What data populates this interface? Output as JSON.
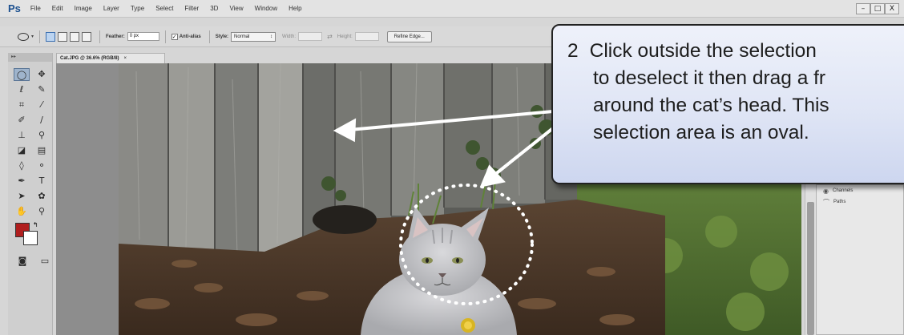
{
  "app": {
    "logo": "Ps",
    "menu": [
      "File",
      "Edit",
      "Image",
      "Layer",
      "Type",
      "Select",
      "Filter",
      "3D",
      "View",
      "Window",
      "Help"
    ],
    "window_controls": [
      "–",
      "□",
      "X"
    ]
  },
  "options_bar": {
    "feather_label": "Feather:",
    "feather_value": "0 px",
    "antialias_label": "Anti-alias",
    "antialias_checked": true,
    "style_label": "Style:",
    "style_value": "Normal",
    "width_label": "Width:",
    "height_label": "Height:",
    "refine_edge_label": "Refine Edge..."
  },
  "tools_panel": {
    "header": "▸▸",
    "foreground_color": "#b01e1e",
    "background_color": "#ffffff"
  },
  "document": {
    "tab_label": "Cat.JPG @ 36.6% (RGB/8)",
    "tab_close": "×"
  },
  "right_panel": {
    "items": [
      {
        "icon": "channels-icon",
        "label": "Channels"
      },
      {
        "icon": "paths-icon",
        "label": "Paths"
      }
    ]
  },
  "callout": {
    "step_number": "2",
    "lines": [
      "Click outside the selection",
      "to deselect it then drag a fr",
      "around the cat’s head. This",
      "selection area is an oval."
    ]
  },
  "colors": {
    "callout_fill": "#dfe5f5",
    "callout_border": "#222222",
    "arrow": "#ffffff",
    "selection": "#ffffff"
  }
}
